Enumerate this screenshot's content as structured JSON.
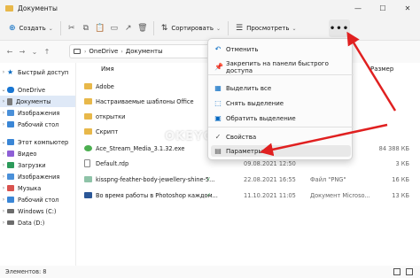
{
  "window": {
    "title": "Документы",
    "controls": {
      "minimize": "—",
      "maximize": "☐",
      "close": "✕"
    }
  },
  "toolbar": {
    "new_label": "Создать",
    "sort_label": "Сортировать",
    "view_label": "Просмотреть",
    "more_label": "•••",
    "icons": [
      "cut-icon",
      "copy-icon",
      "paste-icon",
      "rename-icon",
      "share-icon",
      "delete-icon"
    ]
  },
  "address": {
    "crumbs": [
      "OneDrive",
      "Документы"
    ],
    "separator": "›"
  },
  "sidebar": {
    "items": [
      {
        "label": "Быстрый доступ",
        "icon": "star-icon",
        "color": "#0067c0"
      },
      {
        "label": "OneDrive",
        "icon": "cloud-icon",
        "color": "#1976d2"
      },
      {
        "label": "Документы",
        "icon": "doc-icon",
        "color": "#7a7a7a",
        "selected": true
      },
      {
        "label": "Изображения",
        "icon": "image-icon",
        "color": "#4a90d9"
      },
      {
        "label": "Рабочий стол",
        "icon": "desktop-icon",
        "color": "#3a86d6"
      },
      {
        "label": "Этот компьютер",
        "icon": "pc-icon",
        "color": "#3a86d6"
      },
      {
        "label": "Видео",
        "icon": "video-icon",
        "color": "#8e5fd6"
      },
      {
        "label": "Загрузки",
        "icon": "download-icon",
        "color": "#2c9a5a"
      },
      {
        "label": "Изображения",
        "icon": "image-icon",
        "color": "#4a90d9"
      },
      {
        "label": "Музыка",
        "icon": "music-icon",
        "color": "#d9534f"
      },
      {
        "label": "Рабочий стол",
        "icon": "desktop-icon",
        "color": "#3a86d6"
      },
      {
        "label": "Windows (C:)",
        "icon": "drive-icon",
        "color": "#6c6c6c"
      },
      {
        "label": "Data (D:)",
        "icon": "drive-icon",
        "color": "#6c6c6c"
      }
    ]
  },
  "columns": {
    "name": "Имя",
    "size": "Размер"
  },
  "files": [
    {
      "name": "Adobe",
      "type_icon": "folder",
      "status": "",
      "date": "",
      "kind": "",
      "size": ""
    },
    {
      "name": "Настраиваемые шаблоны Office",
      "type_icon": "folder",
      "status": "",
      "date": "",
      "kind": "",
      "size": ""
    },
    {
      "name": "открытки",
      "type_icon": "folder",
      "status": "",
      "date": "",
      "kind": "",
      "size": ""
    },
    {
      "name": "Скрипт",
      "type_icon": "folder",
      "status": "",
      "date": "",
      "kind": "",
      "size": ""
    },
    {
      "name": "Ace_Stream_Media_3.1.32.exe",
      "type_icon": "exe",
      "status": "",
      "date": "",
      "kind": "",
      "size": "84 388 КБ"
    },
    {
      "name": "Default.rdp",
      "type_icon": "doc",
      "status": "",
      "date": "09.08.2021 12:50",
      "kind": "",
      "size": "3 КБ"
    },
    {
      "name": "kisspng-feather-body-jewellery-shine-5...",
      "type_icon": "img",
      "status": "✓",
      "date": "22.08.2021 16:55",
      "kind": "Файл \"PNG\"",
      "size": "16 КБ"
    },
    {
      "name": "Во время работы в Photoshop каждом...",
      "type_icon": "word",
      "status": "✓",
      "date": "11.10.2021 11:05",
      "kind": "Документ Microso...",
      "size": "13 КБ"
    }
  ],
  "status": {
    "count": "Элементов: 8"
  },
  "menu": {
    "items": [
      {
        "label": "Отменить",
        "icon": "undo-icon"
      },
      {
        "label": "Закрепить на панели быстрого доступа",
        "icon": "pin-icon"
      },
      {
        "label": "Выделить все",
        "icon": "select-all-icon"
      },
      {
        "label": "Снять выделение",
        "icon": "select-none-icon"
      },
      {
        "label": "Обратить выделение",
        "icon": "invert-selection-icon"
      },
      {
        "label": "Свойства",
        "icon": "properties-icon"
      },
      {
        "label": "Параметры",
        "icon": "options-icon"
      }
    ]
  },
  "watermark": "OKEYGEEK",
  "colors": {
    "accent": "#0067c0",
    "folder": "#e8b84a",
    "arrow": "#e02020",
    "sync_ok": "#2e9b48"
  }
}
